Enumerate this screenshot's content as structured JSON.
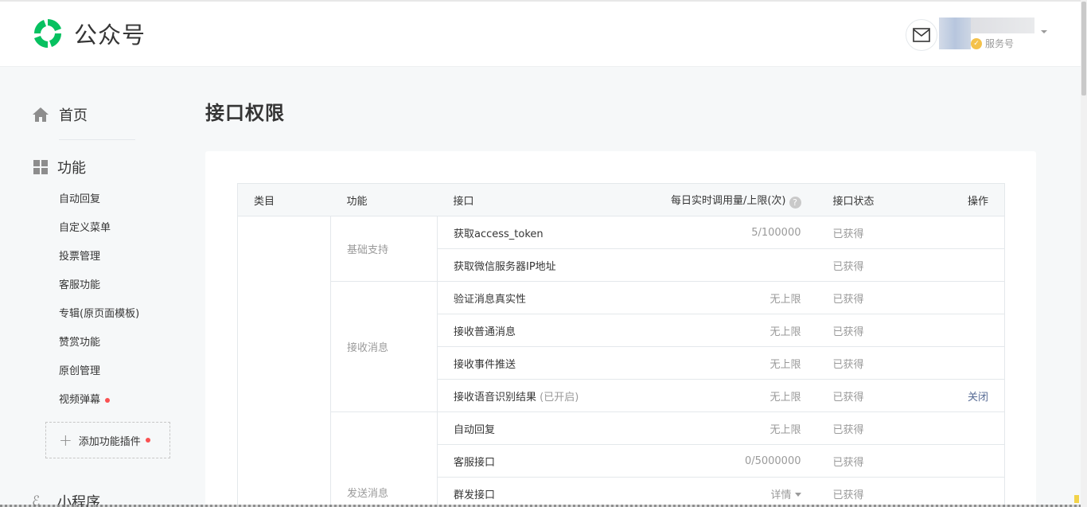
{
  "header": {
    "logo_text": "公众号",
    "account_type": "服务号",
    "brand_color": "#07c160"
  },
  "sidebar": {
    "home_label": "首页",
    "function_label": "功能",
    "items": [
      {
        "label": "自动回复",
        "badge": false
      },
      {
        "label": "自定义菜单",
        "badge": false
      },
      {
        "label": "投票管理",
        "badge": false
      },
      {
        "label": "客服功能",
        "badge": false
      },
      {
        "label": "专辑(原页面模板)",
        "badge": false
      },
      {
        "label": "赞赏功能",
        "badge": false
      },
      {
        "label": "原创管理",
        "badge": false
      },
      {
        "label": "视频弹幕",
        "badge": true
      }
    ],
    "add_plugin_label": "添加功能插件",
    "mini_program_label": "小程序"
  },
  "main": {
    "title": "接口权限",
    "table": {
      "headers": {
        "category": "类目",
        "function": "功能",
        "api": "接口",
        "usage": "每日实时调用量/上限(次)",
        "status": "接口状态",
        "operation": "操作"
      },
      "groups": [
        {
          "function": "基础支持",
          "rows": [
            {
              "api": "获取access_token",
              "note": "",
              "usage": "5/100000",
              "status": "已获得",
              "op": ""
            },
            {
              "api": "获取微信服务器IP地址",
              "note": "",
              "usage": "",
              "status": "已获得",
              "op": ""
            }
          ]
        },
        {
          "function": "接收消息",
          "rows": [
            {
              "api": "验证消息真实性",
              "note": "",
              "usage": "无上限",
              "status": "已获得",
              "op": ""
            },
            {
              "api": "接收普通消息",
              "note": "",
              "usage": "无上限",
              "status": "已获得",
              "op": ""
            },
            {
              "api": "接收事件推送",
              "note": "",
              "usage": "无上限",
              "status": "已获得",
              "op": ""
            },
            {
              "api": "接收语音识别结果",
              "note": "(已开启)",
              "usage": "无上限",
              "status": "已获得",
              "op": "关闭"
            }
          ]
        },
        {
          "function": "发送消息",
          "rows": [
            {
              "api": "自动回复",
              "note": "",
              "usage": "无上限",
              "status": "已获得",
              "op": ""
            },
            {
              "api": "客服接口",
              "note": "",
              "usage": "0/5000000",
              "status": "已获得",
              "op": ""
            },
            {
              "api": "群发接口",
              "note": "",
              "usage": "详情",
              "status": "已获得",
              "op": "",
              "usage_dropdown": true
            }
          ]
        }
      ]
    }
  }
}
